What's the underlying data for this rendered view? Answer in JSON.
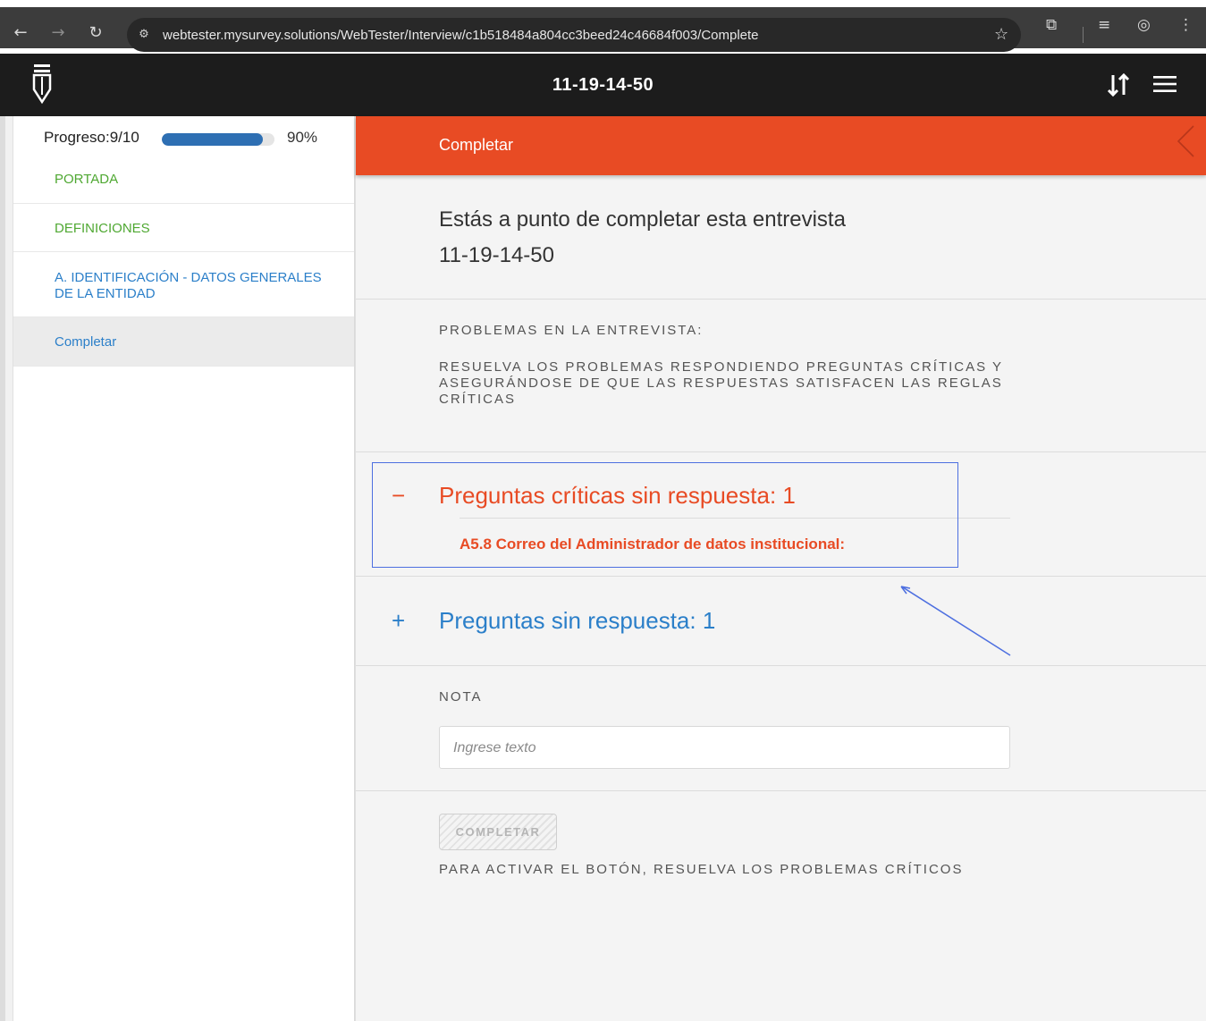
{
  "browser": {
    "url": "webtester.mysurvey.solutions/WebTester/Interview/c1b518484a804cc3beed24c46684f003/Complete",
    "icons": [
      "back-icon",
      "forward-icon",
      "reload-icon",
      "site-info-icon",
      "bookmark-star-icon",
      "extensions-icon",
      "media-icon",
      "profile-icon",
      "more-icon"
    ]
  },
  "header": {
    "title": "11-19-14-50"
  },
  "sidebar": {
    "progress_label": "Progreso:9/10",
    "progress_fraction": 0.9,
    "progress_percent": "90%",
    "items": [
      {
        "label": "PORTADA"
      },
      {
        "label": "DEFINICIONES"
      },
      {
        "label": "A. IDENTIFICACIÓN - DATOS GENERALES DE LA ENTIDAD"
      },
      {
        "label": "Completar"
      }
    ]
  },
  "main": {
    "section_title": "Completar",
    "intro_line1": "Estás a punto de completar esta entrevista",
    "intro_line2": "11-19-14-50",
    "problems_title": "PROBLEMAS EN LA ENTREVISTA:",
    "problems_text": "RESUELVA LOS PROBLEMAS RESPONDIENDO PREGUNTAS CRÍTICAS Y ASEGURÁNDOSE DE QUE LAS RESPUESTAS SATISFACEN LAS REGLAS CRÍTICAS",
    "critical_symbol": "−",
    "critical_heading": "Preguntas críticas sin respuesta: 1",
    "critical_question": "A5.8 Correo del Administrador de datos institucional:",
    "unanswered_symbol": "+",
    "unanswered_heading": "Preguntas sin respuesta: 1",
    "note_label": "NOTA",
    "note_placeholder": "Ingrese texto",
    "complete_button": "COMPLETAR",
    "activate_hint": "PARA ACTIVAR EL BOTÓN, RESUELVA LOS PROBLEMAS CRÍTICOS"
  },
  "colors": {
    "accent_orange": "#e84b24",
    "link_blue": "#2b7fc9",
    "done_green": "#4fa832",
    "header_dark": "#1c1c1c",
    "annotation_blue": "#4d6fe0"
  }
}
